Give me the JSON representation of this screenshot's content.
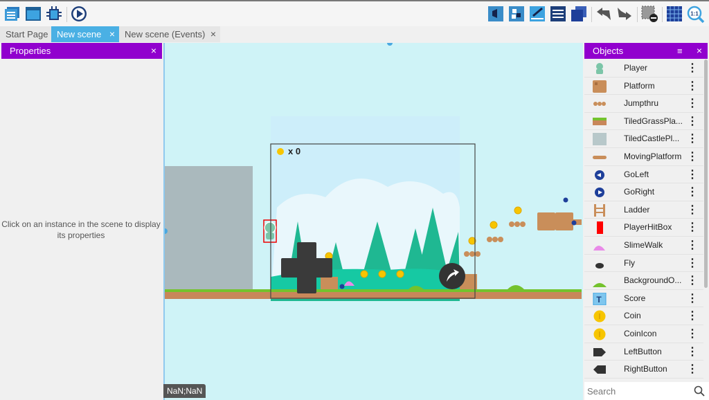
{
  "toolbar": {
    "left": [
      {
        "icon": "project-manager-icon"
      },
      {
        "icon": "scene-window-icon"
      },
      {
        "icon": "debugger-icon"
      },
      {
        "icon": "preview-play-icon"
      }
    ],
    "right": [
      {
        "icon": "objects-panel-icon"
      },
      {
        "icon": "object-groups-icon"
      },
      {
        "icon": "properties-edit-icon"
      },
      {
        "icon": "instances-list-icon"
      },
      {
        "icon": "layers-icon"
      },
      {
        "icon": "undo-icon"
      },
      {
        "icon": "redo-icon"
      },
      {
        "icon": "delete-selection-icon"
      },
      {
        "icon": "grid-icon"
      },
      {
        "icon": "zoom-reset-icon",
        "text": "1:1"
      }
    ]
  },
  "tabs": [
    {
      "label": "Start Page",
      "active": false
    },
    {
      "label": "New scene",
      "active": true,
      "close": "×"
    },
    {
      "label": "New scene (Events)",
      "active": false,
      "close": "×"
    }
  ],
  "properties": {
    "title": "Properties",
    "close": "×",
    "message": "Click on an instance in the scene to display its properties"
  },
  "objects": {
    "title": "Objects",
    "close": "×",
    "filter_icon": "filter-icon",
    "items": [
      {
        "label": "Player",
        "icon": "player-icon"
      },
      {
        "label": "Platform",
        "icon": "platform-icon"
      },
      {
        "label": "Jumpthru",
        "icon": "jumpthru-icon"
      },
      {
        "label": "TiledGrassPla...",
        "icon": "tiled-grass-icon"
      },
      {
        "label": "TiledCastlePl...",
        "icon": "tiled-castle-icon"
      },
      {
        "label": "MovingPlatform",
        "icon": "moving-platform-icon"
      },
      {
        "label": "GoLeft",
        "icon": "go-left-icon"
      },
      {
        "label": "GoRight",
        "icon": "go-right-icon"
      },
      {
        "label": "Ladder",
        "icon": "ladder-icon"
      },
      {
        "label": "PlayerHitBox",
        "icon": "hitbox-icon"
      },
      {
        "label": "SlimeWalk",
        "icon": "slime-icon"
      },
      {
        "label": "Fly",
        "icon": "fly-icon"
      },
      {
        "label": "BackgroundO...",
        "icon": "background-icon"
      },
      {
        "label": "Score",
        "icon": "text-object-icon"
      },
      {
        "label": "Coin",
        "icon": "coin-icon"
      },
      {
        "label": "CoinIcon",
        "icon": "coin-icon"
      },
      {
        "label": "LeftButton",
        "icon": "left-button-icon"
      },
      {
        "label": "RightButton",
        "icon": "right-button-icon"
      }
    ],
    "search_placeholder": "Search"
  },
  "scene": {
    "score_text": "x 0",
    "cursor_position": "NaN;NaN"
  },
  "colors": {
    "panel_header": "#9100ce",
    "active_tab": "#4ab0e4",
    "scene_bg": "#cff3f7"
  }
}
